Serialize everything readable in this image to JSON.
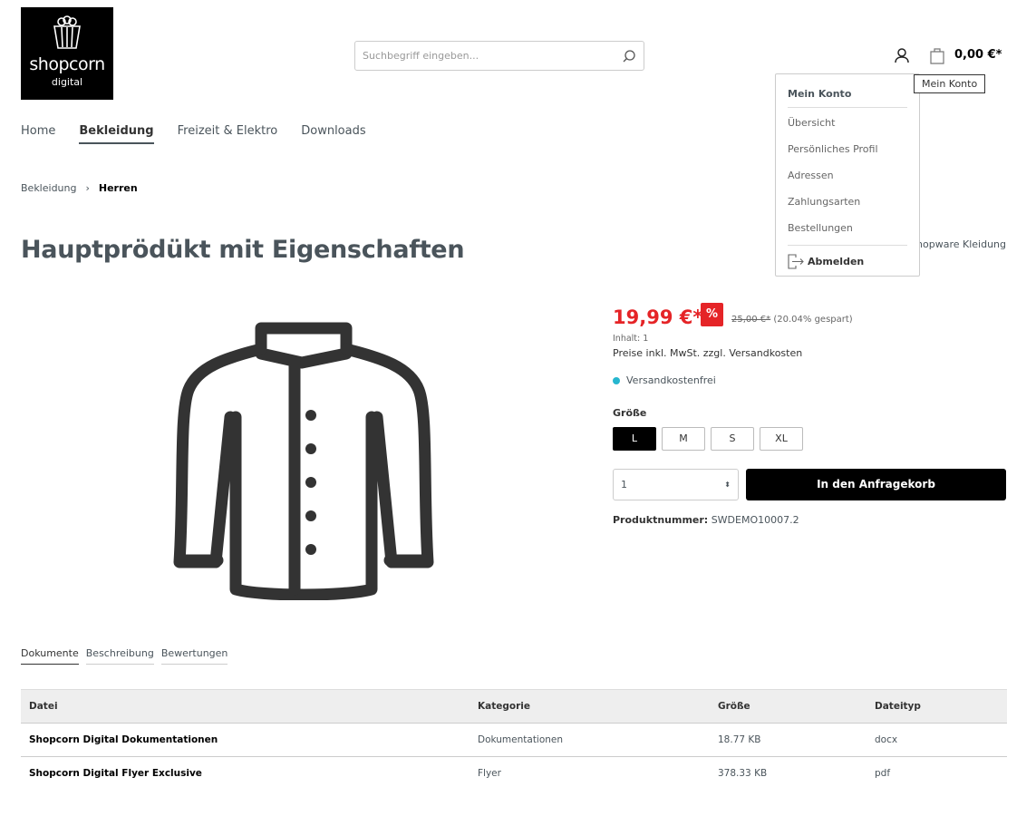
{
  "logo": {
    "text": "shopcorn",
    "sub": "digital"
  },
  "search": {
    "placeholder": "Suchbegriff eingeben..."
  },
  "header": {
    "cart_total": "0,00 €*",
    "account_tooltip": "Mein Konto"
  },
  "nav": [
    "Home",
    "Bekleidung",
    "Freizeit & Elektro",
    "Downloads"
  ],
  "breadcrumb": [
    "Bekleidung",
    "Herren"
  ],
  "product": {
    "title": "Hauptprödükt mit Eigenschaften",
    "manufacturer": "Shopware Kleidung",
    "price": "19,99 €*",
    "badge": "%",
    "old_price": "25,00 €*",
    "saved": "(20.04% gespart)",
    "content": "Inhalt: 1",
    "tax_note": "Preise inkl. MwSt. zzgl. Versandkosten",
    "shipping": "Versandkostenfrei",
    "shipping_color": "#26b6cf",
    "size_label": "Größe",
    "sizes": [
      "L",
      "M",
      "S",
      "XL"
    ],
    "selected_size": "L",
    "quantity": "1",
    "buy_label": "In den Anfragekorb",
    "number_label": "Produktnummer:",
    "number": "SWDEMO10007.2"
  },
  "tabs": [
    "Dokumente",
    "Beschreibung",
    "Bewertungen"
  ],
  "table": {
    "headers": [
      "Datei",
      "Kategorie",
      "Größe",
      "Dateityp"
    ],
    "rows": [
      [
        "Shopcorn Digital Dokumentationen",
        "Dokumentationen",
        "18.77 KB",
        "docx"
      ],
      [
        "Shopcorn Digital Flyer Exclusive",
        "Flyer",
        "378.33 KB",
        "pdf"
      ]
    ]
  },
  "account_menu": {
    "title": "Mein Konto",
    "items": [
      "Übersicht",
      "Persönliches Profil",
      "Adressen",
      "Zahlungsarten",
      "Bestellungen"
    ],
    "logout": "Abmelden"
  }
}
